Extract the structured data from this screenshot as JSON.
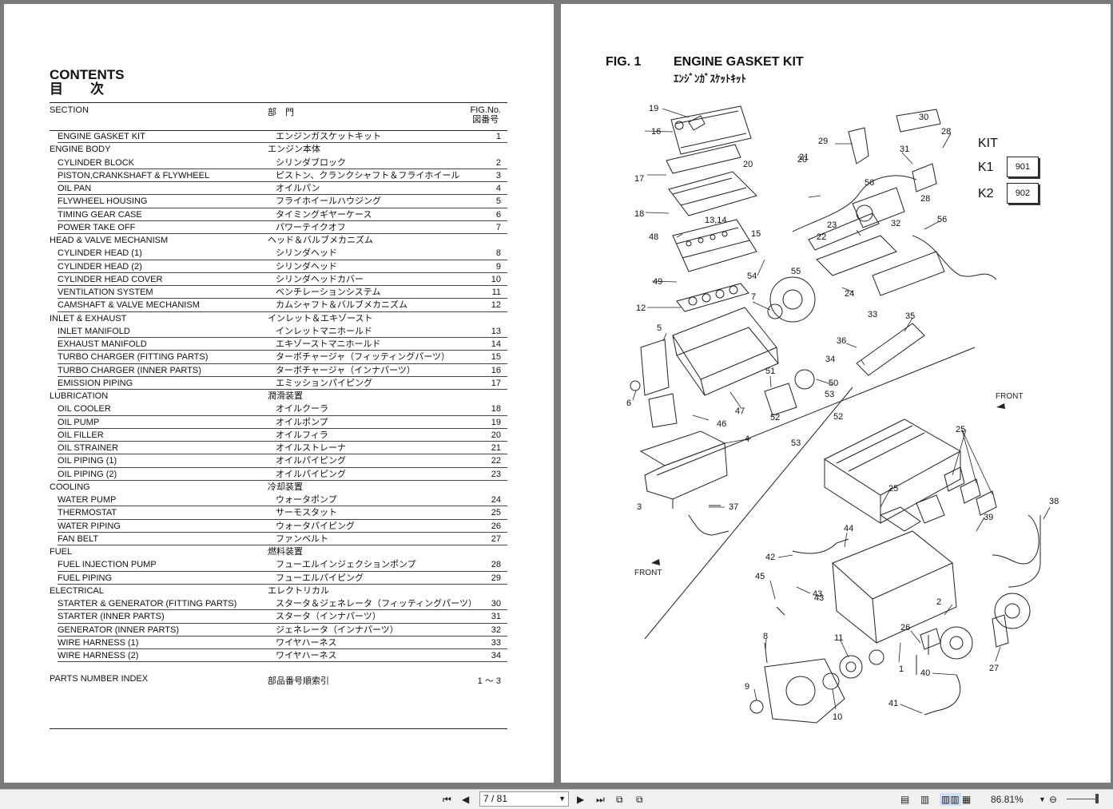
{
  "contents": {
    "title_en": "CONTENTS",
    "title_jp": "目　　次",
    "header_section": "SECTION",
    "header_dept": "部　門",
    "header_fig_en": "FIG.No.",
    "header_fig_jp": "図番号",
    "rows": [
      {
        "en": "ENGINE GASKET KIT",
        "jp": "エンジンガスケットキット",
        "no": "1",
        "sub": true
      },
      {
        "en": "ENGINE BODY",
        "jp": "エンジン本体",
        "no": "",
        "sub": false
      },
      {
        "en": "CYLINDER BLOCK",
        "jp": "シリンダブロック",
        "no": "2",
        "sub": true
      },
      {
        "en": "PISTON,CRANKSHAFT & FLYWHEEL",
        "jp": "ピストン、クランクシャフト＆フライホイール",
        "no": "3",
        "sub": true
      },
      {
        "en": "OIL PAN",
        "jp": "オイルパン",
        "no": "4",
        "sub": true
      },
      {
        "en": "FLYWHEEL HOUSING",
        "jp": "フライホイールハウジング",
        "no": "5",
        "sub": true
      },
      {
        "en": "TIMING GEAR CASE",
        "jp": "タイミングギヤーケース",
        "no": "6",
        "sub": true
      },
      {
        "en": "POWER TAKE OFF",
        "jp": "パワーテイクオフ",
        "no": "7",
        "sub": true
      },
      {
        "en": "HEAD & VALVE MECHANISM",
        "jp": "ヘッド＆バルブメカニズム",
        "no": "",
        "sub": false
      },
      {
        "en": "CYLINDER HEAD (1)",
        "jp": "シリンダヘッド",
        "no": "8",
        "sub": true
      },
      {
        "en": "CYLINDER HEAD (2)",
        "jp": "シリンダヘッド",
        "no": "9",
        "sub": true
      },
      {
        "en": "CYLINDER HEAD COVER",
        "jp": "シリンダヘッドカバー",
        "no": "10",
        "sub": true
      },
      {
        "en": "VENTILATION SYSTEM",
        "jp": "ベンチレーションシステム",
        "no": "11",
        "sub": true
      },
      {
        "en": "CAMSHAFT & VALVE MECHANISM",
        "jp": "カムシャフト＆バルブメカニズム",
        "no": "12",
        "sub": true
      },
      {
        "en": "INLET & EXHAUST",
        "jp": "インレット＆エキゾースト",
        "no": "",
        "sub": false
      },
      {
        "en": "INLET MANIFOLD",
        "jp": "インレットマニホールド",
        "no": "13",
        "sub": true
      },
      {
        "en": "EXHAUST MANIFOLD",
        "jp": "エキゾーストマニホールド",
        "no": "14",
        "sub": true
      },
      {
        "en": "TURBO CHARGER (FITTING PARTS)",
        "jp": "ターボチャージャ（フィッティングパーツ）",
        "no": "15",
        "sub": true
      },
      {
        "en": "TURBO CHARGER (INNER PARTS)",
        "jp": "ターボチャージャ（インナパーツ）",
        "no": "16",
        "sub": true
      },
      {
        "en": "EMISSION PIPING",
        "jp": "エミッションパイピング",
        "no": "17",
        "sub": true
      },
      {
        "en": "LUBRICATION",
        "jp": "潤滑装置",
        "no": "",
        "sub": false
      },
      {
        "en": "OIL COOLER",
        "jp": "オイルクーラ",
        "no": "18",
        "sub": true
      },
      {
        "en": "OIL PUMP",
        "jp": "オイルポンプ",
        "no": "19",
        "sub": true
      },
      {
        "en": "OIL FILLER",
        "jp": "オイルフィラ",
        "no": "20",
        "sub": true
      },
      {
        "en": "OIL STRAINER",
        "jp": "オイルストレーナ",
        "no": "21",
        "sub": true
      },
      {
        "en": "OIL PIPING (1)",
        "jp": "オイルパイピング",
        "no": "22",
        "sub": true
      },
      {
        "en": "OIL PIPING (2)",
        "jp": "オイルパイピング",
        "no": "23",
        "sub": true
      },
      {
        "en": "COOLING",
        "jp": "冷却装置",
        "no": "",
        "sub": false
      },
      {
        "en": "WATER PUMP",
        "jp": "ウォータポンプ",
        "no": "24",
        "sub": true
      },
      {
        "en": "THERMOSTAT",
        "jp": "サーモスタット",
        "no": "25",
        "sub": true
      },
      {
        "en": "WATER PIPING",
        "jp": "ウォータパイピング",
        "no": "26",
        "sub": true
      },
      {
        "en": "FAN BELT",
        "jp": "ファンベルト",
        "no": "27",
        "sub": true
      },
      {
        "en": "FUEL",
        "jp": "燃料装置",
        "no": "",
        "sub": false
      },
      {
        "en": "FUEL INJECTION PUMP",
        "jp": "フューエルインジェクションポンプ",
        "no": "28",
        "sub": true
      },
      {
        "en": "FUEL PIPING",
        "jp": "フューエルパイピング",
        "no": "29",
        "sub": true
      },
      {
        "en": "ELECTRICAL",
        "jp": "エレクトリカル",
        "no": "",
        "sub": false
      },
      {
        "en": "STARTER & GENERATOR (FITTING PARTS)",
        "jp": "スタータ＆ジェネレータ（フィッティングパーツ）",
        "no": "30",
        "sub": true
      },
      {
        "en": "STARTER (INNER PARTS)",
        "jp": "スタータ（インナパーツ）",
        "no": "31",
        "sub": true
      },
      {
        "en": "GENERATOR (INNER PARTS)",
        "jp": "ジェネレータ（インナパーツ）",
        "no": "32",
        "sub": true
      },
      {
        "en": "WIRE HARNESS (1)",
        "jp": "ワイヤハーネス",
        "no": "33",
        "sub": true
      },
      {
        "en": "WIRE HARNESS (2)",
        "jp": "ワイヤハーネス",
        "no": "34",
        "sub": true
      }
    ],
    "index": {
      "en": "PARTS NUMBER INDEX",
      "jp": "部品番号順索引",
      "no": "1 ～ 3"
    }
  },
  "figure": {
    "fig_no": "FIG. 1",
    "title_en": "ENGINE GASKET KIT",
    "title_jp": "ｴﾝｼﾞﾝｶﾞｽｹｯﾄｷｯﾄ",
    "kit_label": "KIT",
    "kits": [
      {
        "label": "K1",
        "code": "901"
      },
      {
        "label": "K2",
        "code": "902"
      }
    ],
    "front_label": "FRONT",
    "callouts": [
      "1",
      "2",
      "3",
      "4",
      "5",
      "6",
      "7",
      "8",
      "9",
      "10",
      "11",
      "12",
      "13,14",
      "15",
      "16",
      "17",
      "18",
      "19",
      "20",
      "21",
      "22",
      "23",
      "24",
      "25",
      "26",
      "27",
      "28",
      "29",
      "30",
      "31",
      "32",
      "33",
      "34",
      "35",
      "36",
      "37",
      "38",
      "39",
      "40",
      "41",
      "42",
      "43",
      "44",
      "45",
      "46",
      "47",
      "48",
      "49",
      "50",
      "51",
      "52",
      "53",
      "54",
      "55",
      "56"
    ]
  },
  "toolbar": {
    "page_value": "7 / 81",
    "zoom": "86.81%",
    "icons": [
      "first-page-icon",
      "prev-page-icon",
      "next-page-icon",
      "last-page-icon",
      "prev-view-icon",
      "next-view-icon",
      "single-page-icon",
      "continuous-icon",
      "facing-icon",
      "continuous-facing-icon",
      "zoom-out-icon"
    ]
  }
}
